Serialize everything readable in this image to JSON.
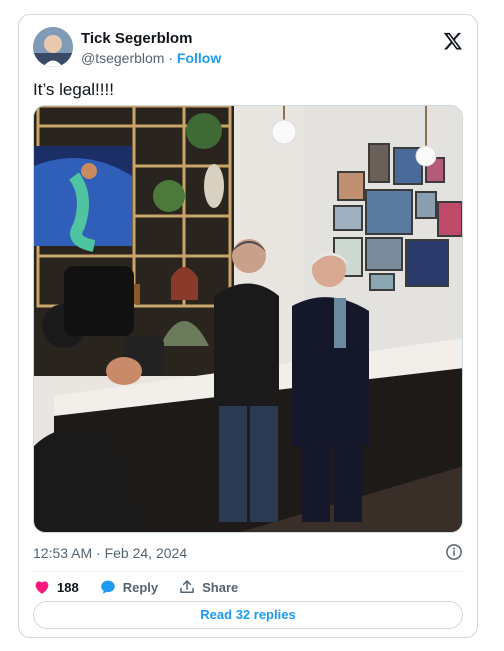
{
  "author": {
    "display_name": "Tick Segerblom",
    "handle": "@tsegerblom",
    "separator": "·",
    "follow_label": "Follow",
    "avatar_icon": "avatar-photo"
  },
  "brand_icon": "x-logo-icon",
  "tweet": {
    "text": "It’s legal!!!!",
    "timestamp": "12:53 AM · Feb 24, 2024"
  },
  "actions": {
    "likes_count": "188",
    "reply_label": "Reply",
    "share_label": "Share"
  },
  "read_replies_label": "Read 32 replies",
  "colors": {
    "accent": "#1d9bf0",
    "like": "#f91880",
    "text_primary": "#0f1419",
    "text_secondary": "#536471",
    "border": "#cfd9de"
  }
}
